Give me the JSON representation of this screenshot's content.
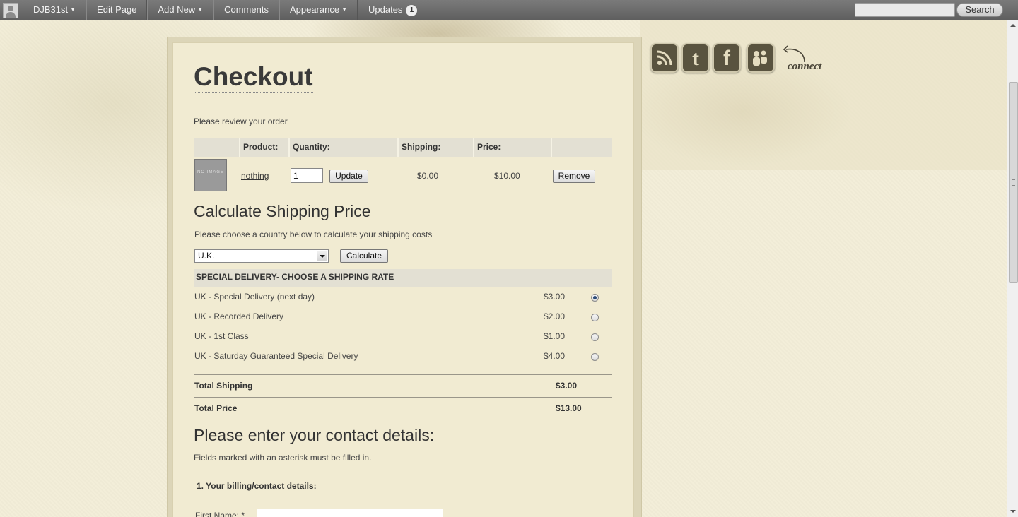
{
  "adminbar": {
    "site_name": "DJB31st",
    "edit_page": "Edit Page",
    "add_new": "Add New",
    "comments": "Comments",
    "appearance": "Appearance",
    "updates": "Updates",
    "updates_count": "1",
    "search_button": "Search",
    "search_value": ""
  },
  "page": {
    "title": "Checkout",
    "review_text": "Please review your order"
  },
  "cart": {
    "headers": [
      "Product:",
      "Quantity:",
      "Shipping:",
      "Price:"
    ],
    "no_image_text": "NO IMAGE",
    "item": {
      "name": "nothing",
      "quantity": "1",
      "update_label": "Update",
      "shipping": "$0.00",
      "price": "$10.00",
      "remove_label": "Remove"
    }
  },
  "shipping": {
    "title": "Calculate Shipping Price",
    "instructions": "Please choose a country below to calculate your shipping costs",
    "country_selected": "U.K.",
    "calculate_label": "Calculate",
    "rates_header": "SPECIAL DELIVERY- CHOOSE A SHIPPING RATE",
    "rates": [
      {
        "label": "UK - Special Delivery (next day)",
        "price": "$3.00",
        "selected": true
      },
      {
        "label": "UK - Recorded Delivery",
        "price": "$2.00",
        "selected": false
      },
      {
        "label": "UK - 1st Class",
        "price": "$1.00",
        "selected": false
      },
      {
        "label": "UK - Saturday Guaranteed Special Delivery",
        "price": "$4.00",
        "selected": false
      }
    ]
  },
  "totals": {
    "shipping_label": "Total Shipping",
    "shipping_value": "$3.00",
    "price_label": "Total Price",
    "price_value": "$13.00"
  },
  "contact": {
    "title": "Please enter your contact details:",
    "note": "Fields marked with an asterisk must be filled in.",
    "section_title": "1. Your billing/contact details:",
    "first_name_label": "First Name: *"
  },
  "social": {
    "connect_label": "connect",
    "icons": [
      "rss-icon",
      "twitter-icon",
      "facebook-icon",
      "myspace-icon"
    ]
  }
}
